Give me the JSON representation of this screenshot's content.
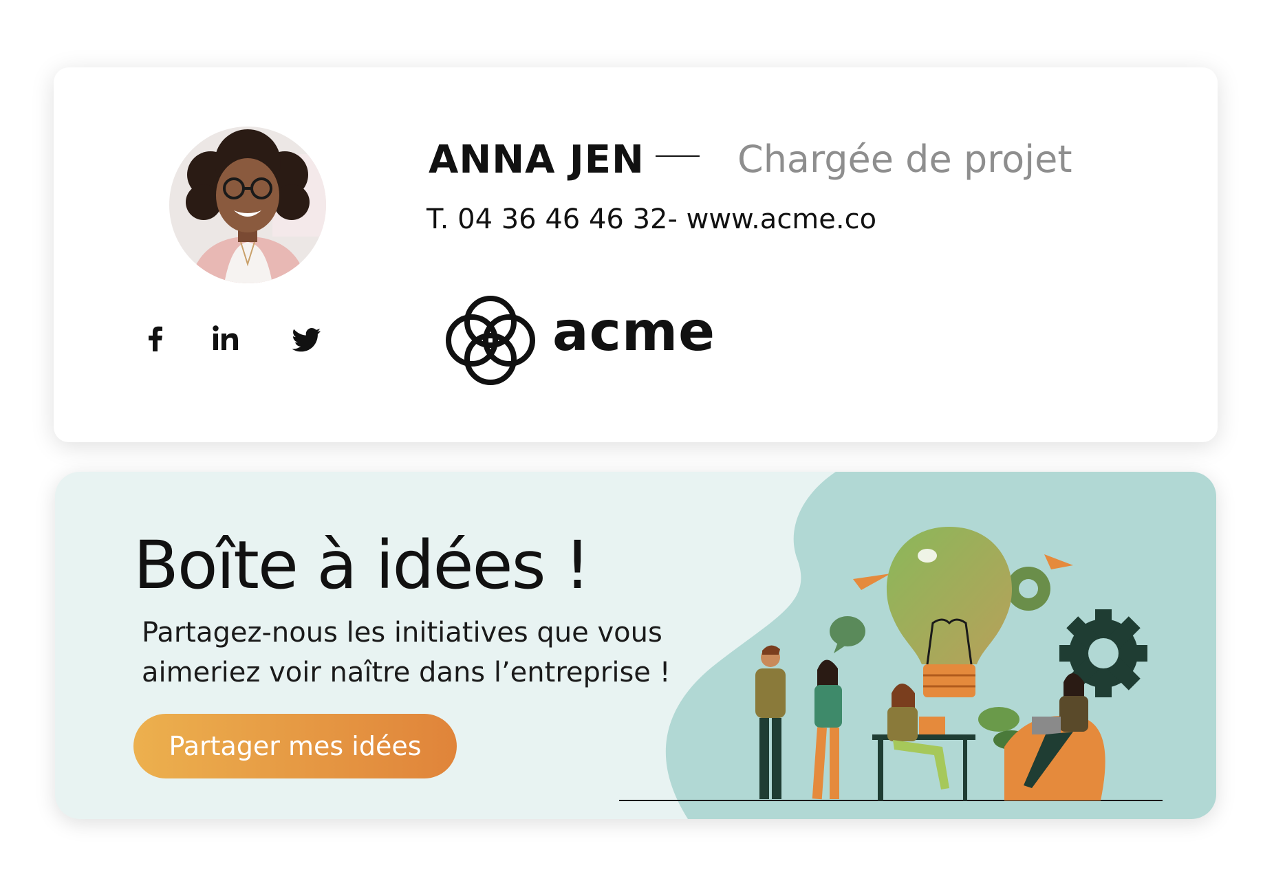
{
  "signature": {
    "name": "ANNA JEN",
    "role": "Chargée de projet",
    "contact_line": "T. 04 36 46 46 32- www.acme.co",
    "company": "acme",
    "social_icons": [
      "facebook-icon",
      "linkedin-icon",
      "twitter-icon"
    ]
  },
  "banner": {
    "title": "Boîte à idées !",
    "text": "Partagez-nous les initiatives que vous aimeriez voir naître dans l’entreprise !",
    "cta_label": "Partager mes idées",
    "colors": {
      "background": "#e8f3f2",
      "blob": "#b1d8d4",
      "cta_start": "#ecb04e",
      "cta_end": "#e0843a"
    }
  }
}
